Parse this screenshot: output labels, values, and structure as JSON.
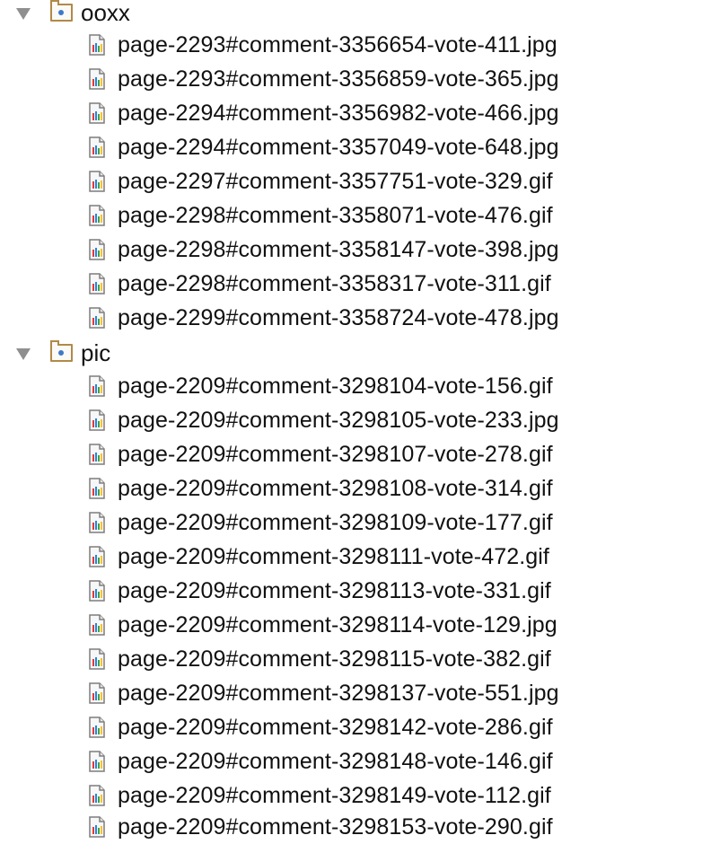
{
  "folders": [
    {
      "name": "ooxx",
      "files": [
        "page-2293#comment-3356654-vote-411.jpg",
        "page-2293#comment-3356859-vote-365.jpg",
        "page-2294#comment-3356982-vote-466.jpg",
        "page-2294#comment-3357049-vote-648.jpg",
        "page-2297#comment-3357751-vote-329.gif",
        "page-2298#comment-3358071-vote-476.gif",
        "page-2298#comment-3358147-vote-398.jpg",
        "page-2298#comment-3358317-vote-311.gif",
        "page-2299#comment-3358724-vote-478.jpg"
      ]
    },
    {
      "name": "pic",
      "files": [
        "page-2209#comment-3298104-vote-156.gif",
        "page-2209#comment-3298105-vote-233.jpg",
        "page-2209#comment-3298107-vote-278.gif",
        "page-2209#comment-3298108-vote-314.gif",
        "page-2209#comment-3298109-vote-177.gif",
        "page-2209#comment-3298111-vote-472.gif",
        "page-2209#comment-3298113-vote-331.gif",
        "page-2209#comment-3298114-vote-129.jpg",
        "page-2209#comment-3298115-vote-382.gif",
        "page-2209#comment-3298137-vote-551.jpg",
        "page-2209#comment-3298142-vote-286.gif",
        "page-2209#comment-3298148-vote-146.gif",
        "page-2209#comment-3298149-vote-112.gif",
        "page-2209#comment-3298153-vote-290.gif"
      ]
    }
  ],
  "icons": {
    "toggle": "disclosure-triangle-down",
    "folder": "folder-icon",
    "file": "image-file-icon"
  },
  "colors": {
    "toggle": "#8f8f8f",
    "folder": "#b08a48",
    "folder_dot": "#3f79c7",
    "text": "#111111"
  }
}
